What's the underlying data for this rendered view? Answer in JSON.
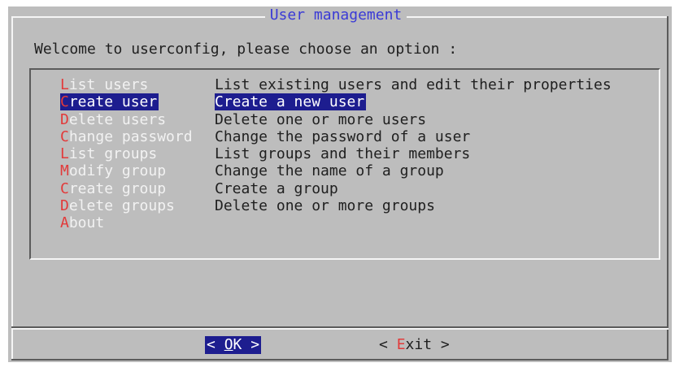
{
  "dialog": {
    "title": "User management",
    "prompt": "Welcome to userconfig, please choose an option :"
  },
  "menu": {
    "selected_index": 1,
    "items": [
      {
        "hotkey": "L",
        "rest": "ist users",
        "description": "List existing users and edit their properties"
      },
      {
        "hotkey": "C",
        "rest": "reate user",
        "description": "Create a new user"
      },
      {
        "hotkey": "D",
        "rest": "elete users",
        "description": "Delete one or more users"
      },
      {
        "hotkey": "C",
        "rest": "hange password",
        "description": "Change the password of a user"
      },
      {
        "hotkey": "L",
        "rest": "ist groups",
        "description": "List groups and their members"
      },
      {
        "hotkey": "M",
        "rest": "odify group",
        "description": "Change the name of a group"
      },
      {
        "hotkey": "C",
        "rest": "reate group",
        "description": "Create a group"
      },
      {
        "hotkey": "D",
        "rest": "elete groups",
        "description": "Delete one or more groups"
      },
      {
        "hotkey": "A",
        "rest": "bout",
        "description": ""
      }
    ]
  },
  "buttons": {
    "ok": {
      "left": "< ",
      "hotkey": "O",
      "rest": "K",
      "right": " >"
    },
    "exit": {
      "left": "< ",
      "hotkey": "E",
      "rest": "xit",
      "right": " >"
    }
  },
  "colors": {
    "background": "#bdbdbd",
    "selection": "#1d1d8f",
    "hotkey": "#e23a3a",
    "title": "#3a3ad6"
  }
}
